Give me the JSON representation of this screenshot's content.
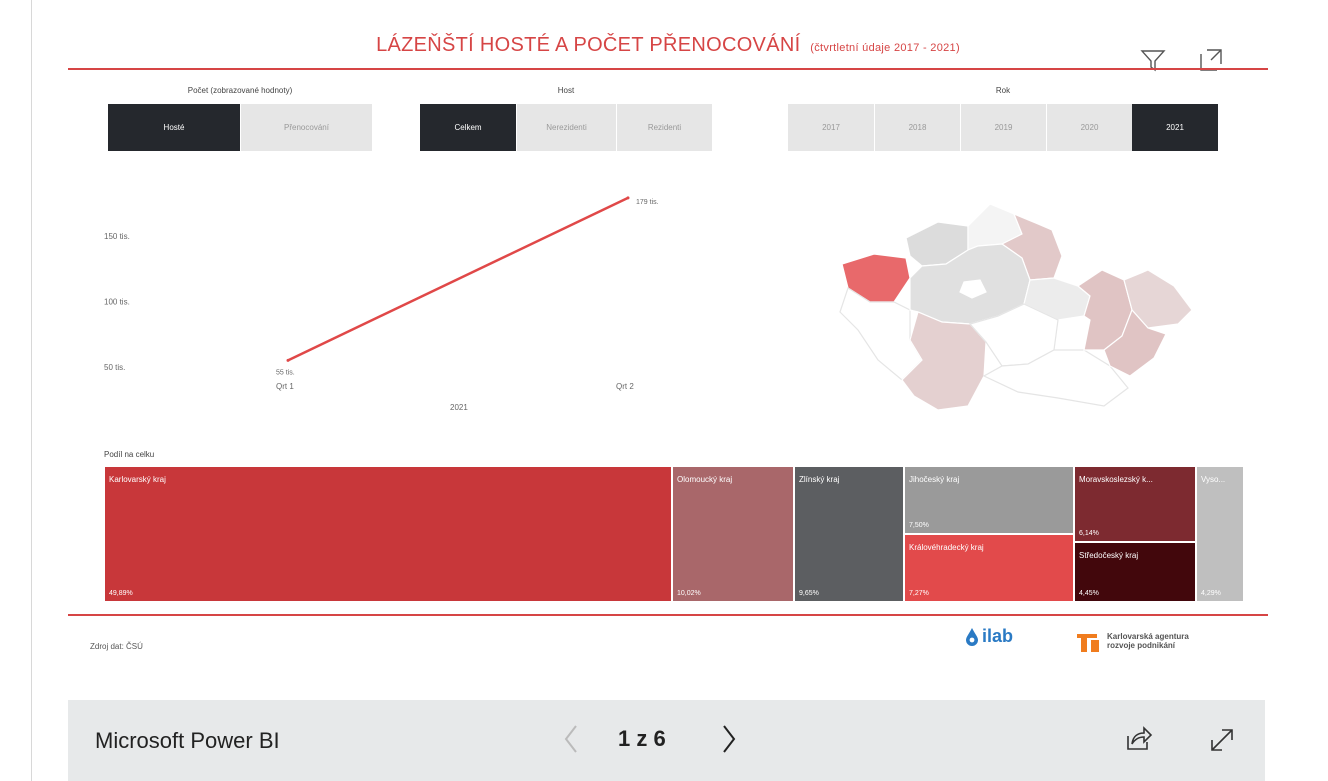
{
  "report": {
    "title": "LÁZEŇŠTÍ HOSTÉ A  POČET PŘENOCOVÁNÍ",
    "subtitle": "(čtvrtletní údaje 2017 - 2021)",
    "toolbar_icons": [
      "filter-icon",
      "expand-icon"
    ]
  },
  "slicers": {
    "metric": {
      "label": "Počet (zobrazované hodnoty)",
      "options": [
        "Hosté",
        "Přenocování"
      ],
      "selected": "Hosté"
    },
    "guest": {
      "label": "Host",
      "options": [
        "Celkem",
        "Nerezidenti",
        "Rezidenti"
      ],
      "selected": "Celkem"
    },
    "year": {
      "label": "Rok",
      "options": [
        "2017",
        "2018",
        "2019",
        "2020",
        "2021"
      ],
      "selected": "2021"
    }
  },
  "chart_data": {
    "type": "line",
    "x": [
      "Qrt 1",
      "Qrt 2"
    ],
    "xgroup": "2021",
    "series": [
      {
        "values": [
          55,
          179
        ],
        "data_labels": [
          "55 tis.",
          "179 tis."
        ],
        "color": "#e04848"
      }
    ],
    "yticks": [
      "150 tis.",
      "100 tis.",
      "50 tis."
    ],
    "ytick_values": [
      150,
      100,
      50
    ],
    "ylim": [
      40,
      185
    ]
  },
  "map": {
    "highlight_color": "#e8696b",
    "regions_shaded": [
      "Karlovarský kraj",
      "Olomoucký kraj",
      "Zlínský kraj",
      "Jihočeský kraj",
      "Královéhradecký kraj",
      "Moravskoslezský kraj",
      "Středočeský kraj"
    ]
  },
  "treemap": {
    "label": "Podíl na celku",
    "tiles": [
      {
        "name": "Karlovarský kraj",
        "pct": "49,89%",
        "color": "#c8373a"
      },
      {
        "name": "Olomoucký kraj",
        "pct": "10,02%",
        "color": "#a9676a"
      },
      {
        "name": "Zlínský kraj",
        "pct": "9,65%",
        "color": "#5c5e61"
      },
      {
        "name": "Jihočeský kraj",
        "pct": "7,50%",
        "color": "#9a9a9a"
      },
      {
        "name": "Královéhradecký kraj",
        "pct": "7,27%",
        "color": "#e24a4b"
      },
      {
        "name": "Moravskoslezský k...",
        "pct": "6,14%",
        "color": "#7d2a30"
      },
      {
        "name": "Středočeský kraj",
        "pct": "4,45%",
        "color": "#42070c"
      },
      {
        "name": "Vyso...",
        "pct": "4,29%",
        "color": "#bfbfbf"
      }
    ]
  },
  "footer": {
    "source": "Zdroj dat: ČSÚ",
    "logo_ilab": "ilab",
    "logo_agency": "Karlovarská agentura rozvoje podnikání"
  },
  "powerbi_bar": {
    "brand": "Microsoft Power BI",
    "pager": "1 z 6"
  }
}
